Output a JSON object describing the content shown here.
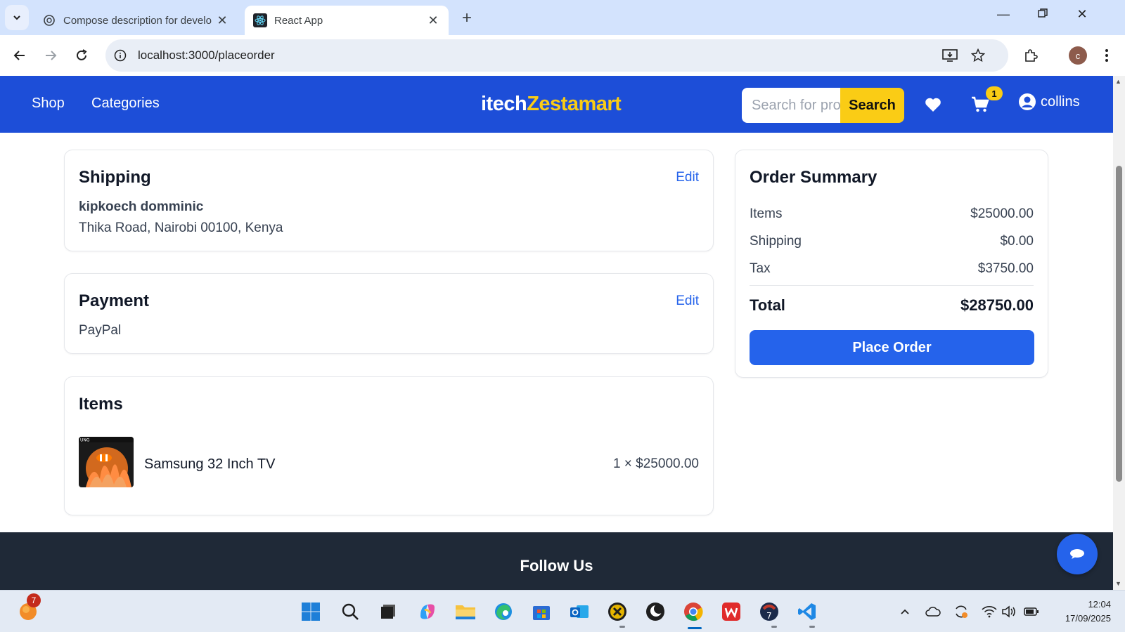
{
  "browser": {
    "tabs": [
      {
        "title": "Compose description for develo",
        "favicon": "openai-icon"
      },
      {
        "title": "React App",
        "favicon": "react-icon"
      }
    ],
    "url": "localhost:3000/placeorder"
  },
  "navbar": {
    "links": [
      "Shop",
      "Categories"
    ],
    "brand_part1": "itech",
    "brand_part2": "Zestamart",
    "search_placeholder": "Search for products...",
    "search_button": "Search",
    "cart_count": "1",
    "username": "collins"
  },
  "shipping": {
    "heading": "Shipping",
    "edit": "Edit",
    "name": "kipkoech domminic",
    "address": "Thika Road, Nairobi 00100, Kenya"
  },
  "payment": {
    "heading": "Payment",
    "edit": "Edit",
    "method": "PayPal"
  },
  "items": {
    "heading": "Items",
    "list": [
      {
        "name": "Samsung 32 Inch TV",
        "qty_price": "1 × $25000.00"
      }
    ]
  },
  "summary": {
    "heading": "Order Summary",
    "items_label": "Items",
    "items_value": "$25000.00",
    "shipping_label": "Shipping",
    "shipping_value": "$0.00",
    "tax_label": "Tax",
    "tax_value": "$3750.00",
    "total_label": "Total",
    "total_value": "$28750.00",
    "button": "Place Order"
  },
  "footer": {
    "follow": "Follow Us"
  },
  "taskbar": {
    "notification_count": "7",
    "time": "12:04",
    "date": "17/09/2025"
  },
  "colors": {
    "primary": "#1d4ed8",
    "button": "#2563eb",
    "accent": "#facc15",
    "footer": "#1f2937"
  }
}
